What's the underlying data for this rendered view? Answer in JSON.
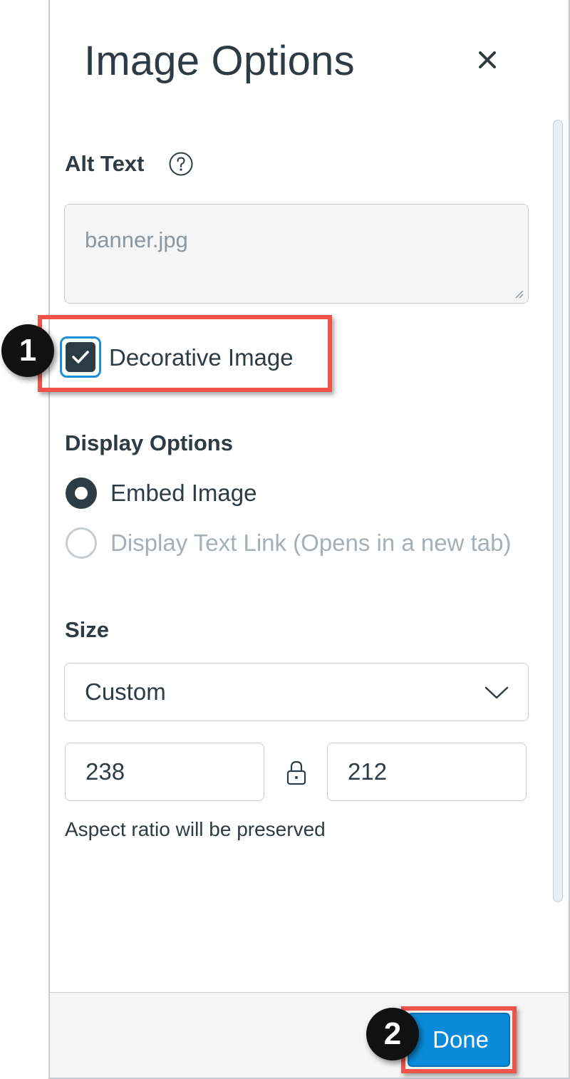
{
  "panel": {
    "title": "Image Options",
    "close_icon": "close-icon"
  },
  "alt_text": {
    "label": "Alt Text",
    "help_icon": "question-circle-icon",
    "value": "banner.jpg"
  },
  "decorative": {
    "label": "Decorative Image",
    "checked": true
  },
  "display_options": {
    "label": "Display Options",
    "options": [
      {
        "label": "Embed Image",
        "selected": true
      },
      {
        "label": "Display Text Link (Opens in a new tab)",
        "selected": false
      }
    ]
  },
  "size": {
    "label": "Size",
    "selected": "Custom",
    "width": "238",
    "height": "212",
    "lock_icon": "lock-icon",
    "note": "Aspect ratio will be preserved"
  },
  "footer": {
    "done_label": "Done"
  },
  "annotations": {
    "badge_1": "1",
    "badge_2": "2",
    "highlight_color": "#f0534a"
  },
  "colors": {
    "text": "#2d3b45",
    "muted": "#8b969e",
    "border": "#c7cdd1",
    "primary": "#0a8ad8",
    "focus": "#1a8ddb"
  }
}
